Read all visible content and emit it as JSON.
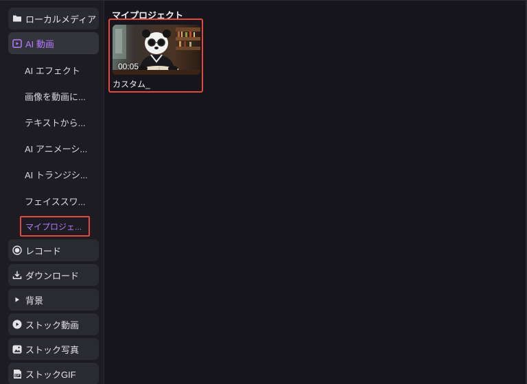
{
  "sidebar": {
    "groups": [
      {
        "label": "ローカルメディア",
        "icon": "folder-icon"
      },
      {
        "label": "AI 動画",
        "icon": "ai-video-icon",
        "active": true
      },
      {
        "label": "レコード",
        "icon": "record-icon"
      },
      {
        "label": "ダウンロード",
        "icon": "download-icon"
      },
      {
        "label": "背景",
        "icon": "play-triangle-icon"
      },
      {
        "label": "ストック動画",
        "icon": "play-circle-icon"
      },
      {
        "label": "ストック写真",
        "icon": "image-icon"
      },
      {
        "label": "ストックGIF",
        "icon": "gif-icon"
      }
    ],
    "ai_sub_items": [
      {
        "label": "AI エフェクト"
      },
      {
        "label": "画像を動画に..."
      },
      {
        "label": "テキストから..."
      },
      {
        "label": "AI アニメーシ..."
      },
      {
        "label": "AI トランジシ..."
      },
      {
        "label": "フェイススワ..."
      },
      {
        "label": "マイプロジェ...",
        "active": true
      }
    ]
  },
  "main": {
    "section_title": "マイプロジェクト",
    "projects": [
      {
        "name": "カスタム_",
        "duration": "00:05"
      }
    ]
  },
  "colors": {
    "accent": "#b57cff",
    "highlight_border": "#e24a40"
  }
}
